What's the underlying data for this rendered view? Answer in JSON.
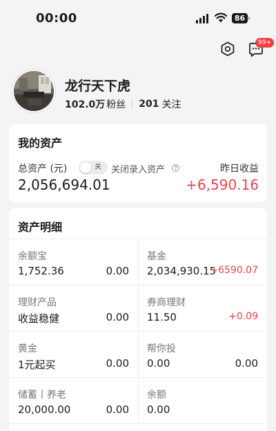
{
  "status": {
    "time": "00:00",
    "battery": "86"
  },
  "header": {
    "notification_badge": "99+"
  },
  "profile": {
    "name": "龙行天下虎",
    "followers_count": "102.0万",
    "followers_label": "粉丝",
    "following_count": "201",
    "following_label": "关注"
  },
  "assets": {
    "title": "我的资产",
    "total_label": "总资产 (元)",
    "toggle_label": "关",
    "manual_entry_label": "关闭录入资产",
    "total_value": "2,056,694.01",
    "yesterday_label": "昨日收益",
    "yesterday_value": "+6,590.16"
  },
  "details": {
    "title": "资产明细",
    "items": [
      {
        "label": "余额宝",
        "primary": "1,752.36",
        "secondary": "0.00"
      },
      {
        "label": "基金",
        "primary": "2,034,930.15",
        "secondary": "+6590.07"
      },
      {
        "label": "理财产品",
        "primary": "收益稳健",
        "secondary": "0.00"
      },
      {
        "label": "券商理财",
        "primary": "11.50",
        "secondary": "+0.09"
      },
      {
        "label": "黄金",
        "primary": "1元起买",
        "secondary": "0.00"
      },
      {
        "label": "帮你投",
        "primary": "0.00",
        "secondary": "0.00"
      },
      {
        "label": "储蓄丨养老",
        "primary": "20,000.00",
        "secondary": "0.00"
      },
      {
        "label": "余额",
        "primary": "0.00",
        "secondary": ""
      }
    ]
  },
  "colors": {
    "gain": "#f0414b",
    "background": "#f4f4f6",
    "badge": "#f23d3d"
  }
}
